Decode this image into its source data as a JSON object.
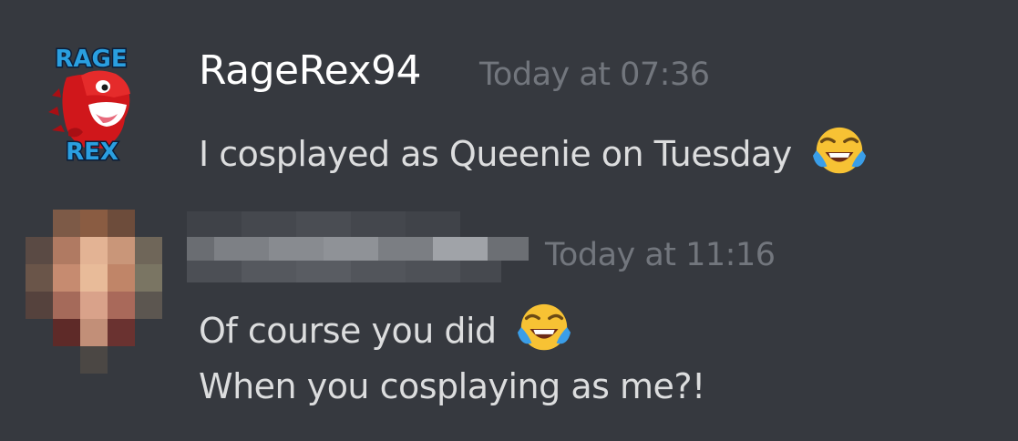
{
  "messages": [
    {
      "author": "RageRex94",
      "timestamp": "Today at 07:36",
      "avatar_text_top": "RAGE",
      "avatar_text_bottom": "REX",
      "lines": [
        "I cosplayed as Queenie on Tuesday"
      ],
      "emoji": "laughing-with-tears"
    },
    {
      "author": "",
      "author_redacted": true,
      "timestamp": "Today at 11:16",
      "lines": [
        "Of course you did",
        "When you cosplaying as me?!"
      ],
      "emoji": "laughing-with-tears"
    }
  ],
  "colors": {
    "background": "#36393f",
    "username": "#ffffff",
    "timestamp": "#72767d",
    "message_text": "#dcddde",
    "avatar_accent": "#e02020"
  }
}
